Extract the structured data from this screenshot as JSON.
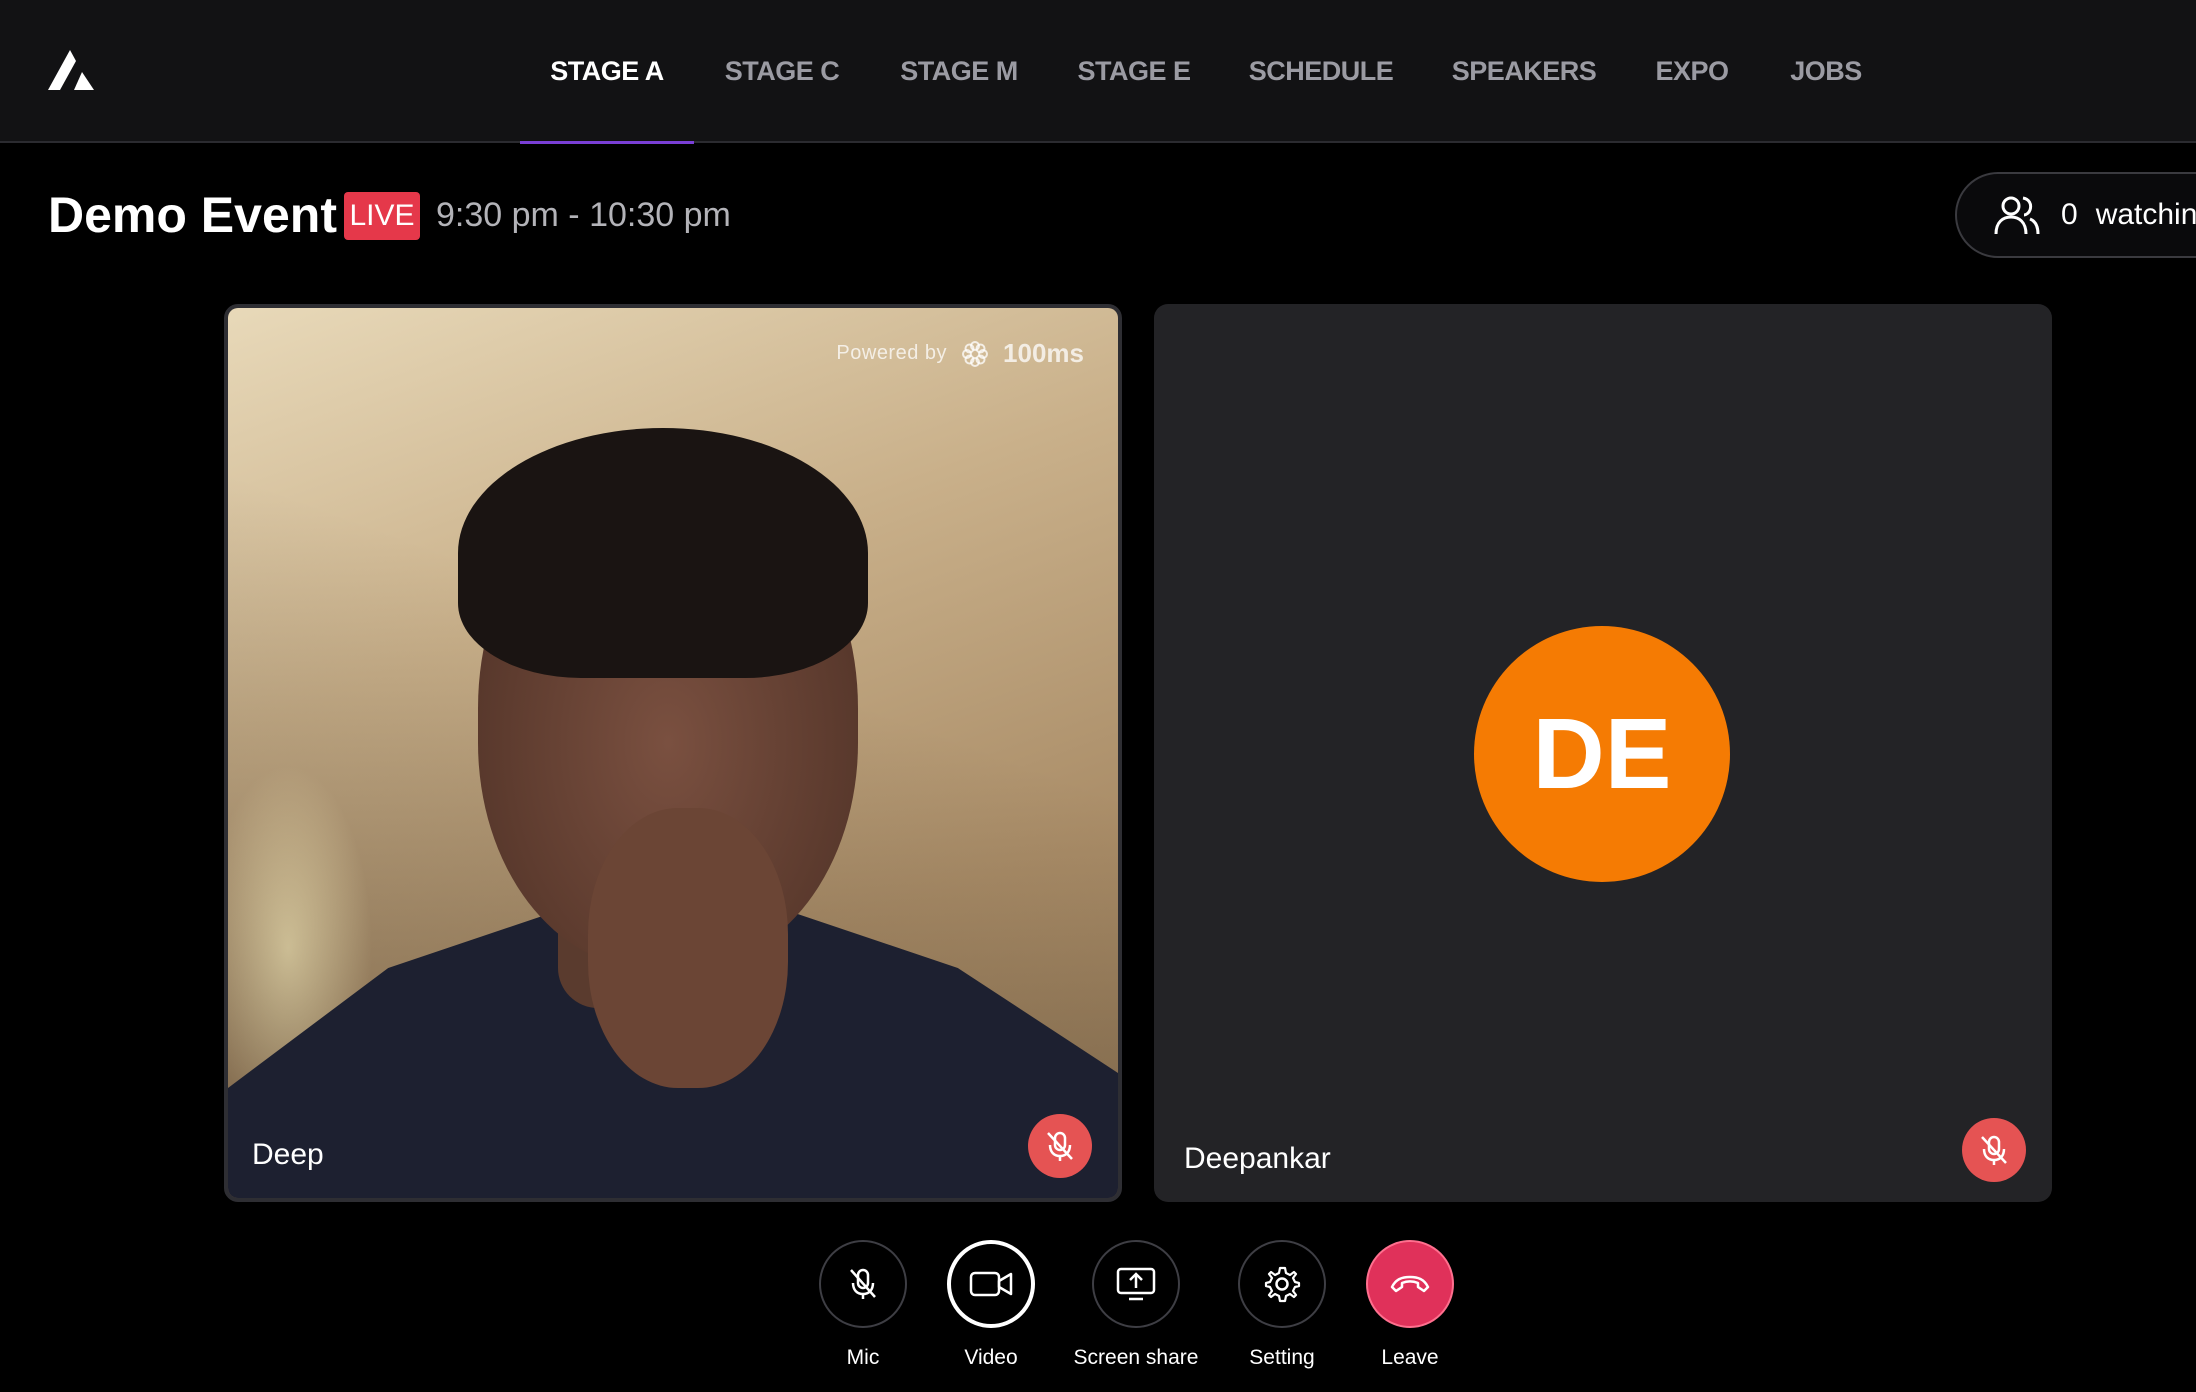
{
  "nav": {
    "items": [
      {
        "label": "STAGE A",
        "active": true
      },
      {
        "label": "STAGE C",
        "active": false
      },
      {
        "label": "STAGE M",
        "active": false
      },
      {
        "label": "STAGE E",
        "active": false
      },
      {
        "label": "SCHEDULE",
        "active": false
      },
      {
        "label": "SPEAKERS",
        "active": false
      },
      {
        "label": "EXPO",
        "active": false
      },
      {
        "label": "JOBS",
        "active": false
      }
    ]
  },
  "event": {
    "title": "Demo Event",
    "live_label": "LIVE",
    "time": "9:30 pm - 10:30 pm",
    "watching_count": "0",
    "watching_label": "watching"
  },
  "tiles": [
    {
      "name": "Deep",
      "muted": true,
      "powered_by_label": "Powered by",
      "powered_by_brand": "100ms"
    },
    {
      "name": "Deepankar",
      "initials": "DE",
      "avatar_color": "#f57b03",
      "muted": true
    }
  ],
  "controls": [
    {
      "label": "Mic",
      "icon": "mic-off-icon"
    },
    {
      "label": "Video",
      "icon": "video-icon"
    },
    {
      "label": "Screen share",
      "icon": "screen-share-icon"
    },
    {
      "label": "Setting",
      "icon": "gear-icon"
    },
    {
      "label": "Leave",
      "icon": "phone-hangup-icon"
    }
  ],
  "colors": {
    "accent": "#7a3fd6",
    "live": "#e5384a",
    "mute": "#e55353",
    "leave": "#e0315a"
  }
}
